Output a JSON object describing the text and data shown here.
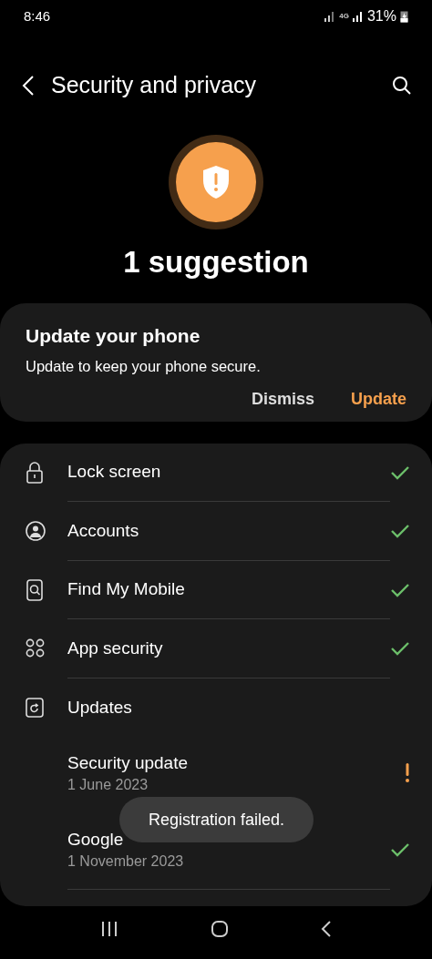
{
  "status_bar": {
    "time": "8:46",
    "network": "4G",
    "battery": "31%"
  },
  "header": {
    "title": "Security and privacy"
  },
  "summary": {
    "title": "1 suggestion"
  },
  "suggestion": {
    "title": "Update your phone",
    "text": "Update to keep your phone secure.",
    "actions": [
      {
        "label": "Dismiss",
        "kind": "secondary"
      },
      {
        "label": "Update",
        "kind": "primary"
      }
    ]
  },
  "items": [
    {
      "label": "Lock screen",
      "kind": "lock",
      "checked": true
    },
    {
      "label": "Accounts",
      "kind": "account",
      "checked": true
    },
    {
      "label": "Find My Mobile",
      "kind": "find",
      "checked": true
    },
    {
      "label": "App security",
      "kind": "apps",
      "checked": true
    },
    {
      "label": "Updates",
      "kind": "update",
      "checked": false,
      "children": [
        {
          "label": "Security update",
          "date": "1 June 2023",
          "attention": true
        },
        {
          "label": "Google",
          "date": "1 November 2023",
          "attention": false
        }
      ]
    }
  ],
  "toast": "Registration failed."
}
